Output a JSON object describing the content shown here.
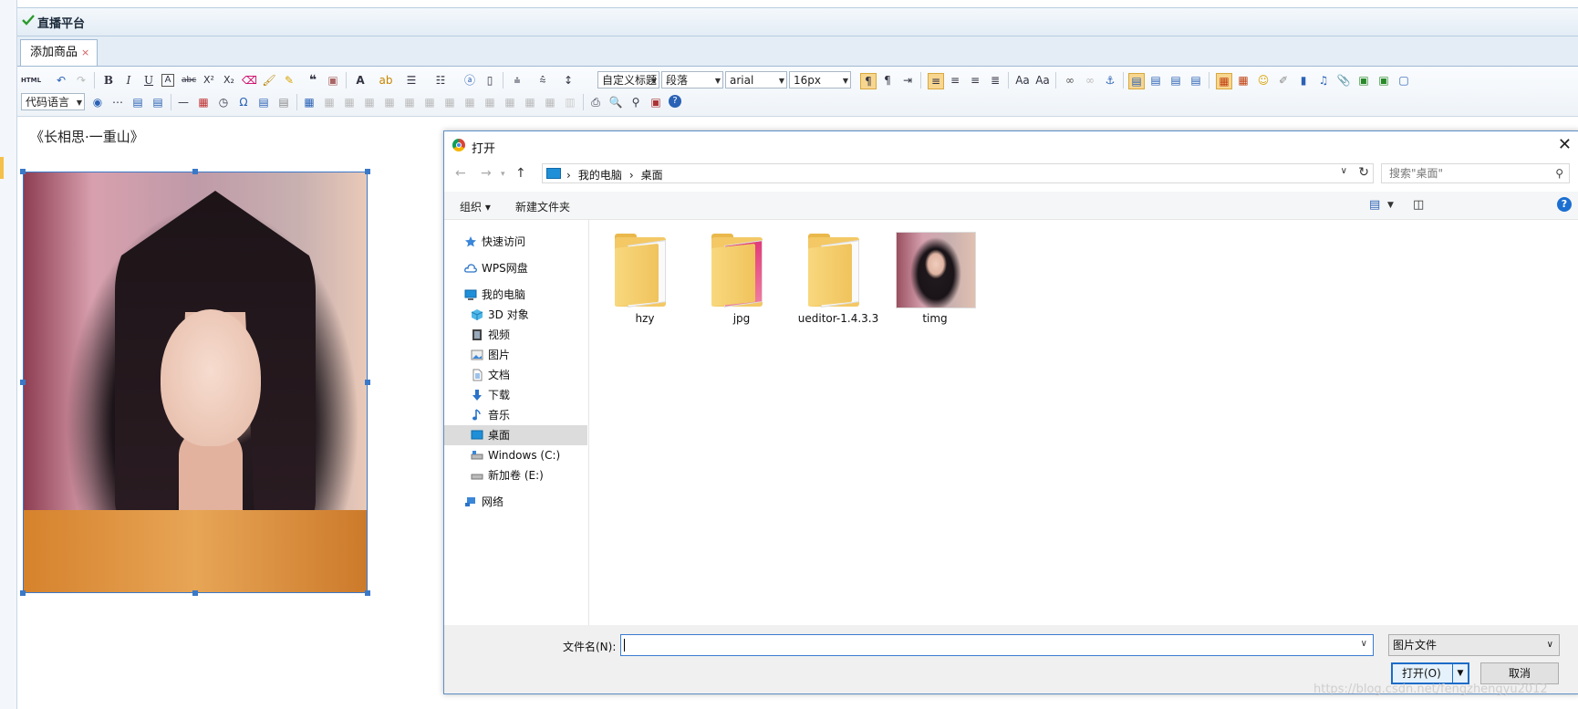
{
  "app": {
    "title": "直播平台"
  },
  "tabs": [
    {
      "label": "添加商品",
      "close": "×"
    }
  ],
  "toolbar": {
    "html_label": "HTML",
    "heading_select": "自定义标题",
    "paragraph_select": "段落",
    "font_select": "arial",
    "size_select": "16px",
    "code_lang_select": "代码语言"
  },
  "editor": {
    "poem_title": "《长相思·一重山》"
  },
  "dialog": {
    "title": "打开",
    "breadcrumbs": [
      "我的电脑",
      "桌面"
    ],
    "search_placeholder": "搜索\"桌面\"",
    "commands": {
      "organize": "组织 ▾",
      "new_folder": "新建文件夹"
    },
    "sidebar": [
      {
        "label": "快速访问",
        "icon": "star-icon"
      },
      {
        "label": "WPS网盘",
        "icon": "cloud-icon"
      },
      {
        "label": "我的电脑",
        "icon": "computer-icon"
      },
      {
        "label": "3D 对象",
        "icon": "cube-icon"
      },
      {
        "label": "视频",
        "icon": "film-icon"
      },
      {
        "label": "图片",
        "icon": "picture-icon"
      },
      {
        "label": "文档",
        "icon": "document-icon"
      },
      {
        "label": "下载",
        "icon": "download-icon"
      },
      {
        "label": "音乐",
        "icon": "music-icon"
      },
      {
        "label": "桌面",
        "icon": "desktop-icon",
        "selected": true
      },
      {
        "label": "Windows (C:)",
        "icon": "drive-icon"
      },
      {
        "label": "新加卷 (E:)",
        "icon": "drive-icon"
      },
      {
        "label": "网络",
        "icon": "network-icon"
      }
    ],
    "files": [
      {
        "name": "hzy",
        "kind": "folder"
      },
      {
        "name": "jpg",
        "kind": "folder"
      },
      {
        "name": "ueditor-1.4.3.3",
        "kind": "folder"
      },
      {
        "name": "timg",
        "kind": "image"
      }
    ],
    "filename_label": "文件名(N):",
    "filename_value": "",
    "filetype_value": "图片文件",
    "open_button": "打开(O)",
    "cancel_button": "取消"
  },
  "watermark": "https://blog.csdn.net/fengzhengyu2012",
  "colors": {
    "accent": "#1d6cc8",
    "selection": "#dcdcdc",
    "folder": "#f3c865"
  }
}
